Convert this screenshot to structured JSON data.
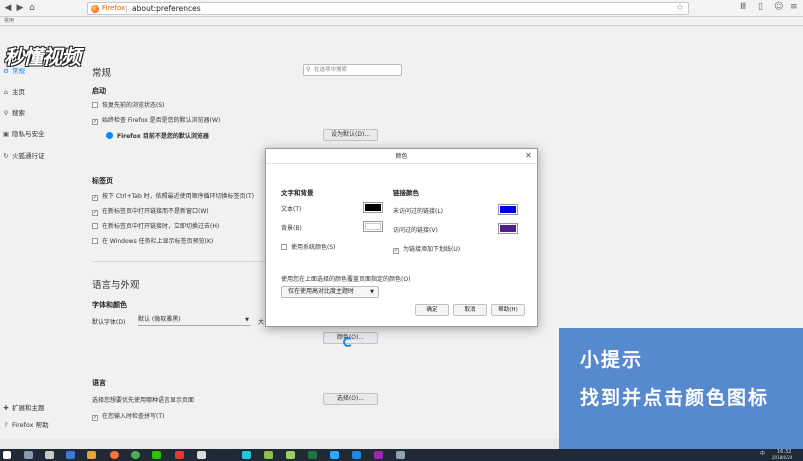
{
  "browser": {
    "brand": "Firefox",
    "url": "about:preferences",
    "bookmarks_text": "常用"
  },
  "watermark": "秒懂视频",
  "search": {
    "placeholder": "在选项中搜索"
  },
  "sidebar": {
    "items": [
      {
        "label": "常规",
        "icon": "gear-icon",
        "active": true
      },
      {
        "label": "主页",
        "icon": "home-icon"
      },
      {
        "label": "搜索",
        "icon": "search-icon"
      },
      {
        "label": "隐私与安全",
        "icon": "lock-icon"
      },
      {
        "label": "火狐通行证",
        "icon": "sync-icon"
      }
    ],
    "footer": [
      {
        "label": "扩展和主题",
        "icon": "puzzle-icon"
      },
      {
        "label": "Firefox 帮助",
        "icon": "help-icon"
      }
    ]
  },
  "general": {
    "title": "常规",
    "startup": {
      "heading": "启动",
      "restore_session": "恢复先前的浏览状态(S)",
      "check_default": "始终检查 Firefox 是否是您的默认浏览器(W)",
      "not_default": "Firefox 目前不是您的默认浏览器",
      "set_default_button": "设为默认(D)..."
    },
    "tabs": {
      "heading": "标签页",
      "opt1": "按下 Ctrl+Tab 时，依照最近使用顺序循环切换标签页(T)",
      "opt2": "在新标签页中打开链接而不是新窗口(W)",
      "opt3": "在新标签页中打开链接时，立即切换过去(H)",
      "opt4": "在 Windows 任务栏上显示标签页预览(K)"
    }
  },
  "appearance": {
    "title": "语言与外观",
    "fonts_heading": "字体和颜色",
    "default_font_label": "默认字体(D)",
    "default_font_value": "默认 (微软雅黑)",
    "size_label": "大",
    "colors_button": "颜色(O)..."
  },
  "language": {
    "heading": "语言",
    "desc": "选择您想要优先使用哪种语言显示页面",
    "choose_button": "选择(O)...",
    "spellcheck": "在您输入时检查拼写(T)"
  },
  "dialog": {
    "title": "颜色",
    "text_bg_heading": "文字和背景",
    "text_label": "文本(T)",
    "text_color": "#000000",
    "bg_label": "背景(B)",
    "bg_color": "#ffffff",
    "use_system": "使用系统颜色(S)",
    "link_heading": "链接颜色",
    "unvisited_label": "未访问过的链接(L)",
    "unvisited_color": "#0000ee",
    "visited_label": "访问过的链接(V)",
    "visited_color": "#551a8b",
    "underline": "为链接添加下划线(U)",
    "override_label": "使用您在上面选择的颜色覆盖页面指定的颜色(O)",
    "override_value": "仅在使用高对比度主题时",
    "ok": "确定",
    "cancel": "取消",
    "help": "帮助(H)"
  },
  "tip": {
    "line1": "小提示",
    "line2": "找到并点击颜色图标"
  },
  "taskbar": {
    "ime": "中",
    "time": "16:32",
    "date": "2018/6/24"
  }
}
